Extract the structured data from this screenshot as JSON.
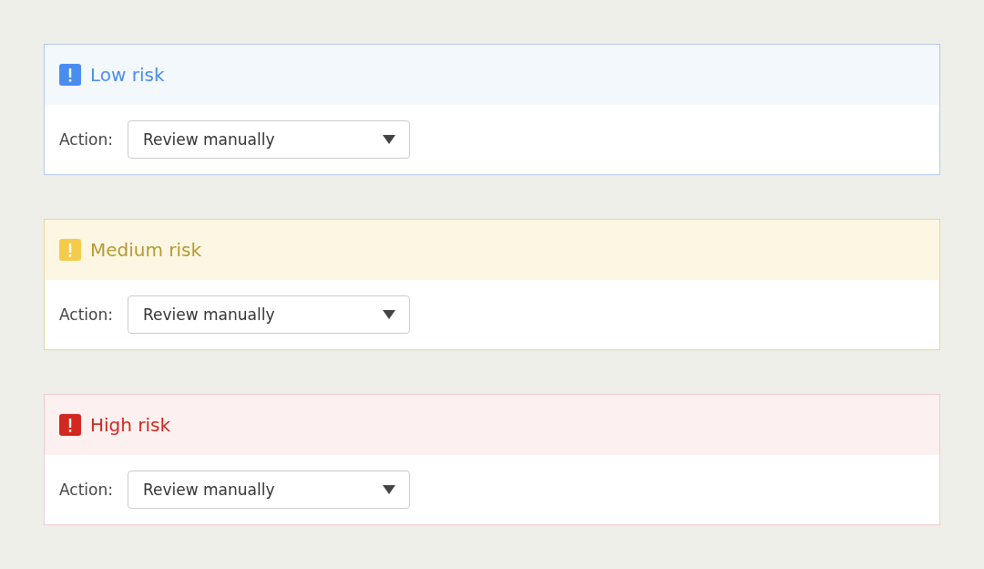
{
  "panels": [
    {
      "kind": "low",
      "title": "Low risk",
      "action_label": "Action:",
      "action_value": "Review manually"
    },
    {
      "kind": "medium",
      "title": "Medium risk",
      "action_label": "Action:",
      "action_value": "Review manually"
    },
    {
      "kind": "high",
      "title": "High risk",
      "action_label": "Action:",
      "action_value": "Review manually"
    }
  ]
}
